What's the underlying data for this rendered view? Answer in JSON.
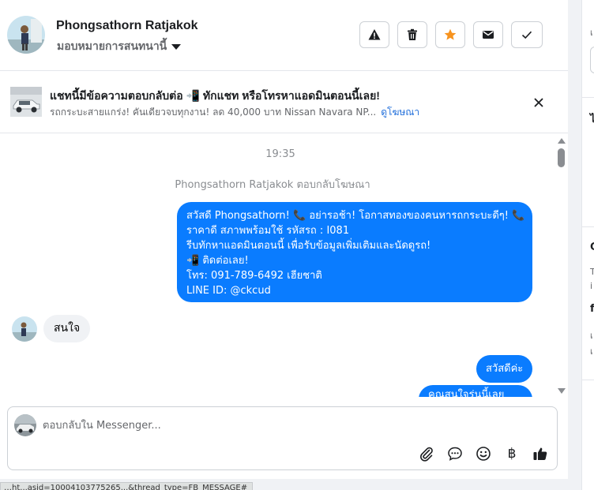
{
  "header": {
    "contact_name": "Phongsathorn Ratjakok",
    "assign_label": "มอบหมายการสนทนานี้",
    "actions": [
      "report-icon",
      "trash-icon",
      "star-icon",
      "mail-icon",
      "check-icon"
    ]
  },
  "ad_banner": {
    "title": "แชทนี้มีข้อความตอบกลับต่อ 📲 ทักแชท หรือโทรหาแอดมินตอนนี้เลย!",
    "subtitle": "รถกระบะสายแกร่ง! คันเดียวจบทุกงาน! ลด 40,000 บาท Nissan Navara NP...",
    "link": "ดูโฆษณา"
  },
  "thread": {
    "time": "19:35",
    "system_note": "Phongsathorn Ratjakok ตอบกลับโฆษณา",
    "ad_message_lines": [
      "สวัสดี Phongsathorn! 📞 อย่ารอช้า! โอกาสทองของคนหารถกระบะดีๆ! 📞",
      "ราคาดี สภาพพร้อมใช้ รหัสรถ : I081",
      "รีบทักหาแอดมินตอนนี้ เพื่อรับข้อมูลเพิ่มเติมและนัดดูรถ!",
      "📲 ติดต่อเลย!",
      "โทร: 091-789-6492 เฮียชาติ",
      "LINE ID: @ckcud"
    ],
    "incoming_message": "สนใจ",
    "outgoing_1": "สวัสดีค่ะ",
    "outgoing_2": "คุณสนใจรุ่นนี้เลย"
  },
  "composer": {
    "placeholder": "ตอบกลับใน Messenger...",
    "tools": [
      "attach-icon",
      "chat-bubble-icon",
      "emoji-icon",
      "baht-icon",
      "thumbs-up-icon"
    ],
    "baht_symbol": "฿"
  },
  "status_bar": {
    "text": "…ht...asid=10004103775265...&thread_type=FB_MESSAGE#"
  },
  "right_panel": {
    "fragments": [
      "เ",
      "ไ",
      "C",
      "T",
      "i",
      "f",
      "เ",
      "เ"
    ]
  },
  "colors": {
    "accent": "#0a7cff",
    "star": "#f7931e",
    "link": "#216fdb"
  }
}
